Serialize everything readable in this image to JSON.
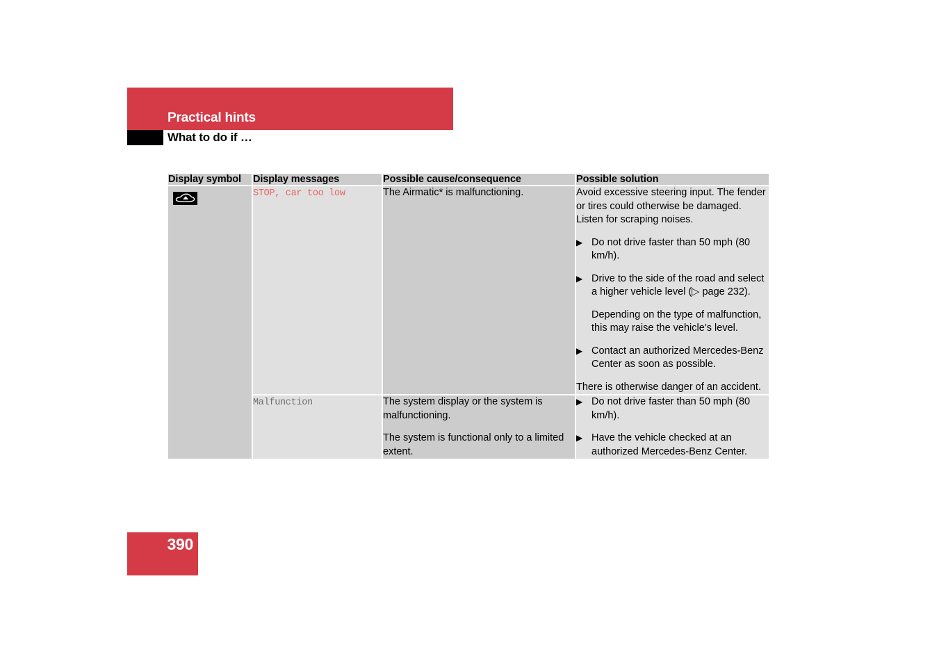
{
  "header": {
    "banner_title": "Practical hints",
    "subtitle": "What to do if …"
  },
  "table": {
    "columns": [
      {
        "key": "display_symbol",
        "label": "Display symbol"
      },
      {
        "key": "display_messages",
        "label": "Display messages"
      },
      {
        "key": "possible_cause",
        "label": "Possible cause/consequence"
      },
      {
        "key": "possible_solution",
        "label": "Possible solution"
      }
    ],
    "symbol": {
      "icon_name": "car-lowered-suspension-icon",
      "background_color": "#000000",
      "foreground_color": "#ffffff"
    },
    "rows": [
      {
        "message": "STOP, car too low",
        "message_color": "#e8635f",
        "cause": "The Airmatic* is malfunctioning.",
        "solution_intro": "Avoid excessive steering input. The fender or tires could otherwise be damaged. Listen for scraping noises.",
        "solution_bullets": [
          "Do not drive faster than 50 mph (80 km/h).",
          "Drive to the side of the road and select a higher vehicle level (▷ page 232)."
        ],
        "solution_note": "Depending on the type of malfunction, this may raise the vehicle’s level.",
        "solution_bullet_last": "Contact an authorized Mercedes-Benz Center as soon as possible.",
        "solution_outro": "There is otherwise danger of an accident."
      },
      {
        "message": "Malfunction",
        "message_color": "#6f6f6f",
        "cause_1": "The system display or the system is malfunctioning.",
        "cause_2": "The system is functional only to a limited extent.",
        "solution_bullets": [
          "Do not drive faster than 50 mph (80 km/h).",
          "Have the vehicle checked at an authorized Mercedes-Benz Center."
        ]
      }
    ],
    "bullet_glyph": "▶"
  },
  "footer": {
    "page_number": "390"
  },
  "colors": {
    "accent_red": "#d53a47",
    "header_gray": "#cccccc",
    "cell_dark": "#cccccc",
    "cell_light": "#e0e0e0"
  }
}
